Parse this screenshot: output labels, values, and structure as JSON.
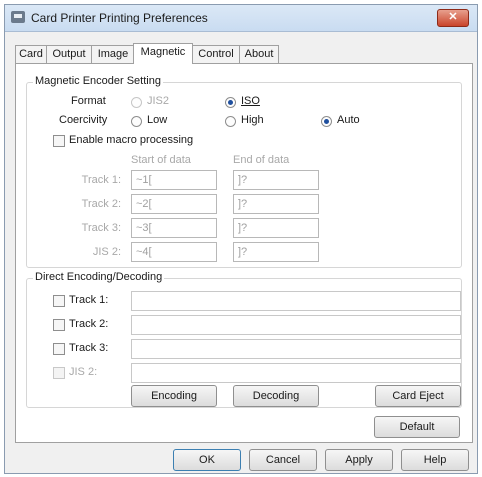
{
  "window": {
    "title": "Card Printer Printing Preferences",
    "close_glyph": "✕"
  },
  "tabs": [
    {
      "label": "Card"
    },
    {
      "label": "Output"
    },
    {
      "label": "Image"
    },
    {
      "label": "Magnetic"
    },
    {
      "label": "Control"
    },
    {
      "label": "About"
    }
  ],
  "active_tab": "Magnetic",
  "encoder": {
    "title": "Magnetic Encoder Setting",
    "format_label": "Format",
    "format_options": [
      {
        "label": "JIS2",
        "selected": false,
        "enabled": false
      },
      {
        "label": "ISO",
        "selected": true,
        "enabled": true
      }
    ],
    "coercivity_label": "Coercivity",
    "coercivity_options": [
      {
        "label": "Low",
        "selected": false
      },
      {
        "label": "High",
        "selected": false
      },
      {
        "label": "Auto",
        "selected": true
      }
    ],
    "macro_label": "Enable macro processing",
    "macro_checked": false,
    "start_header": "Start of data",
    "end_header": "End of data",
    "tracks": [
      {
        "label": "Track 1:",
        "start": "~1[",
        "end": "]?"
      },
      {
        "label": "Track 2:",
        "start": "~2[",
        "end": "]?"
      },
      {
        "label": "Track 3:",
        "start": "~3[",
        "end": "]?"
      },
      {
        "label": "JIS 2:",
        "start": "~4[",
        "end": "]?"
      }
    ]
  },
  "direct": {
    "title": "Direct Encoding/Decoding",
    "tracks": [
      {
        "label": "Track 1:",
        "value": "",
        "enabled": true
      },
      {
        "label": "Track 2:",
        "value": "",
        "enabled": true
      },
      {
        "label": "Track 3:",
        "value": "",
        "enabled": true
      },
      {
        "label": "JIS 2:",
        "value": "",
        "enabled": false
      }
    ],
    "encoding_btn": "Encoding",
    "decoding_btn": "Decoding",
    "eject_btn": "Card Eject"
  },
  "default_btn": "Default",
  "footer": {
    "ok": "OK",
    "cancel": "Cancel",
    "apply": "Apply",
    "help": "Help"
  },
  "colors": {
    "accent": "#1f4f9e",
    "disabled_text": "#a8a8a8",
    "close_button": "#c9442a"
  }
}
